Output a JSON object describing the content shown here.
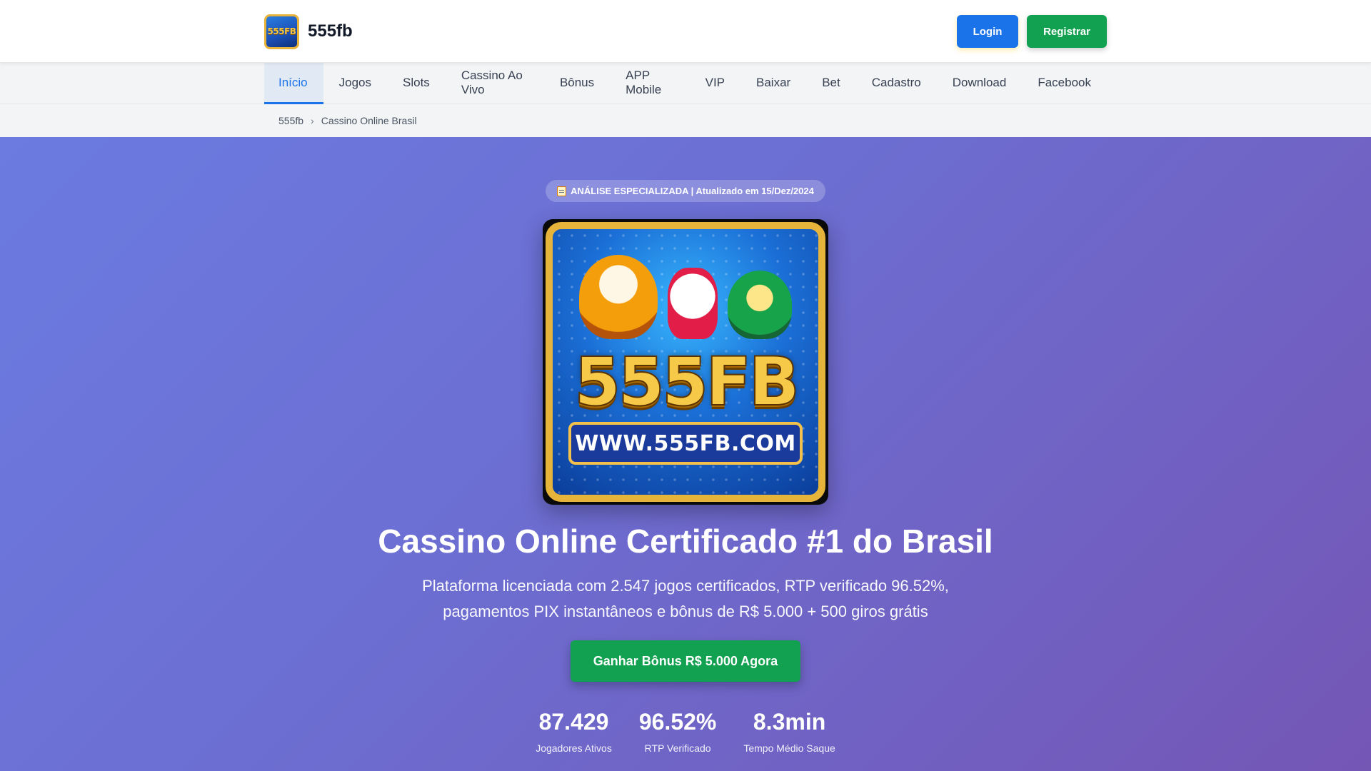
{
  "header": {
    "brand_name": "555fb",
    "brand_logo_text": "555FB",
    "login_label": "Login",
    "register_label": "Registrar"
  },
  "nav": {
    "items": [
      {
        "label": "Início",
        "active": true
      },
      {
        "label": "Jogos"
      },
      {
        "label": "Slots"
      },
      {
        "label": "Cassino Ao Vivo"
      },
      {
        "label": "Bônus"
      },
      {
        "label": "APP Mobile"
      },
      {
        "label": "VIP"
      },
      {
        "label": "Baixar"
      },
      {
        "label": "Bet"
      },
      {
        "label": "Cadastro"
      },
      {
        "label": "Download"
      },
      {
        "label": "Facebook"
      }
    ]
  },
  "breadcrumb": {
    "home": "555fb",
    "separator": "›",
    "current": "Cassino Online Brasil"
  },
  "hero": {
    "badge_icon": "memo-icon",
    "badge_text": "ANÁLISE ESPECIALIZADA | Atualizado em 15/Dez/2024",
    "logo_text": "555FB",
    "logo_url_text": "WWW.555FB.COM",
    "title": "Cassino Online Certificado #1 do Brasil",
    "subtitle": "Plataforma licenciada com 2.547 jogos certificados, RTP verificado 96.52%, pagamentos PIX instantâneos e bônus de R$ 5.000 + 500 giros grátis",
    "cta_label": "Ganhar Bônus R$ 5.000 Agora",
    "stats": [
      {
        "value": "87.429",
        "label": "Jogadores Ativos"
      },
      {
        "value": "96.52%",
        "label": "RTP Verificado"
      },
      {
        "value": "8.3min",
        "label": "Tempo Médio Saque"
      }
    ]
  },
  "colors": {
    "primary": "#1a73e8",
    "success": "#12a150",
    "hero_gradient_start": "#6b7be0",
    "hero_gradient_end": "#7456b5",
    "logo_gold": "#e6b43a"
  }
}
